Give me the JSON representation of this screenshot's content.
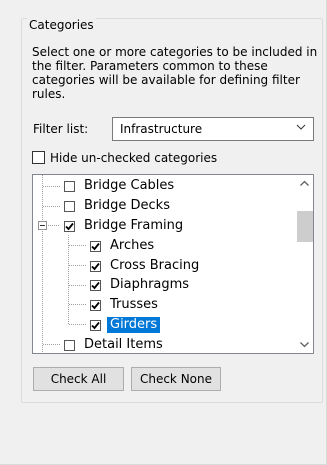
{
  "group": {
    "title": "Categories",
    "description": "Select one or more categories to be included in the filter.  Parameters common to these categories will be available for defining filter rules."
  },
  "filter": {
    "label": "Filter list:",
    "value": "Infrastructure"
  },
  "hide_unchecked": {
    "label": "Hide un-checked categories",
    "checked": false
  },
  "tree": {
    "items": [
      {
        "label": "Bridge Cables",
        "checked": false,
        "level": 1
      },
      {
        "label": "Bridge Decks",
        "checked": false,
        "level": 1
      },
      {
        "label": "Bridge Framing",
        "checked": true,
        "level": 1,
        "expanded": true
      },
      {
        "label": "Arches",
        "checked": true,
        "level": 2
      },
      {
        "label": "Cross Bracing",
        "checked": true,
        "level": 2
      },
      {
        "label": "Diaphragms",
        "checked": true,
        "level": 2
      },
      {
        "label": "Trusses",
        "checked": true,
        "level": 2
      },
      {
        "label": "Girders",
        "checked": true,
        "level": 2,
        "selected": true
      },
      {
        "label": "Detail Items",
        "checked": false,
        "level": 1
      }
    ]
  },
  "buttons": {
    "check_all": "Check All",
    "check_none": "Check None"
  },
  "colors": {
    "selection": "#0078d7",
    "scroll_thumb": "#cdcdcd"
  }
}
